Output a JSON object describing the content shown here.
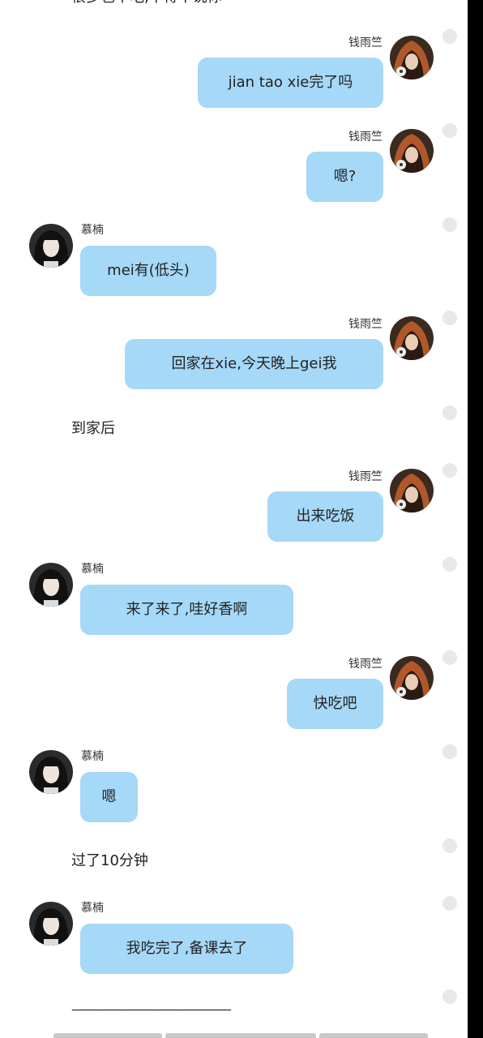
{
  "top_partial_text": "很多也不吃,不得不说你",
  "colors": {
    "bubble": "#a6d8f7",
    "background": "#ffffff",
    "scrollbar": "#000000",
    "dot": "#e8e8e8"
  },
  "messages": [
    {
      "side": "right",
      "sender": "钱雨竺",
      "text": "jian tao xie完了吗",
      "avatar_icon": "hooded-avatar-icon"
    },
    {
      "side": "right",
      "sender": "钱雨竺",
      "text": "嗯?",
      "avatar_icon": "hooded-avatar-icon"
    },
    {
      "side": "left",
      "sender": "慕楠",
      "text": "mei有(低头)",
      "avatar_icon": "girl-avatar-icon"
    },
    {
      "side": "right",
      "sender": "钱雨竺",
      "text": "回家在xie,今天晚上gei我",
      "avatar_icon": "hooded-avatar-icon"
    },
    {
      "side": "right",
      "sender": "钱雨竺",
      "text": "出来吃饭",
      "avatar_icon": "hooded-avatar-icon"
    },
    {
      "side": "left",
      "sender": "慕楠",
      "text": "来了来了,哇好香啊",
      "avatar_icon": "girl-avatar-icon"
    },
    {
      "side": "right",
      "sender": "钱雨竺",
      "text": "快吃吧",
      "avatar_icon": "hooded-avatar-icon"
    },
    {
      "side": "left",
      "sender": "慕楠",
      "text": "嗯",
      "avatar_icon": "girl-avatar-icon"
    },
    {
      "side": "left",
      "sender": "慕楠",
      "text": "我吃完了,备课去了",
      "avatar_icon": "girl-avatar-icon"
    }
  ],
  "narration": {
    "after_home": "到家后",
    "ten_minutes": "过了10分钟",
    "divider": "——————————————"
  }
}
